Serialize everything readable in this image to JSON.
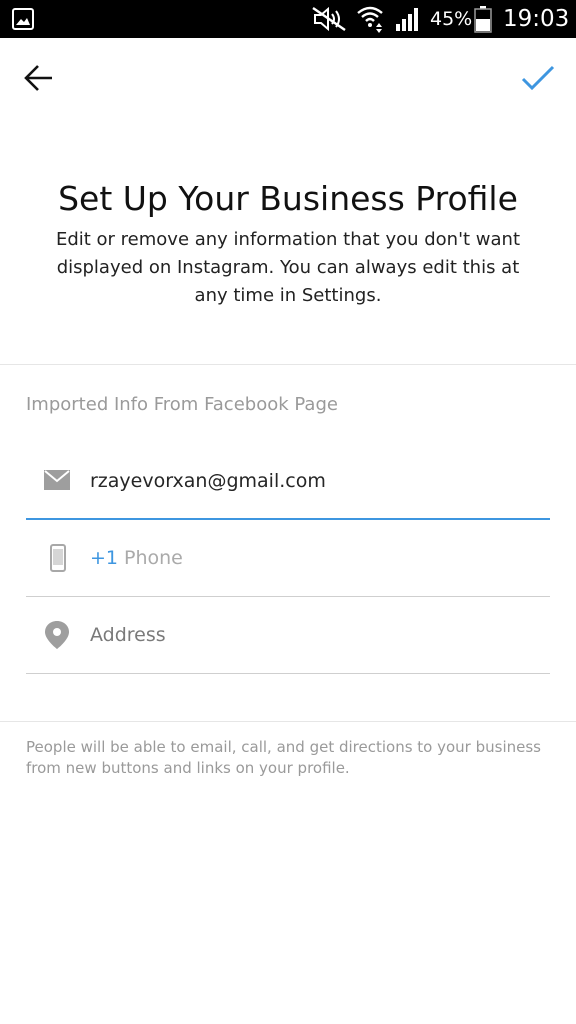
{
  "status_bar": {
    "battery_percent": "45%",
    "time": "19:03",
    "icons": [
      "gallery-icon",
      "mute-icon",
      "wifi-icon",
      "signal-icon",
      "battery-icon"
    ]
  },
  "header": {
    "back_icon": "back-arrow-icon",
    "done_icon": "checkmark-icon",
    "title": "Set Up Your Business Profile",
    "description": "Edit or remove any information that you don't want displayed on Instagram. You can always edit this at any time in Settings."
  },
  "form": {
    "section_label": "Imported Info From Facebook Page",
    "email": {
      "value": "rzayevorxan@gmail.com",
      "icon": "mail-icon"
    },
    "phone": {
      "country_code": "+1",
      "placeholder": "Phone",
      "icon": "phone-icon"
    },
    "address": {
      "placeholder": "Address",
      "icon": "location-pin-icon"
    }
  },
  "footer": {
    "note": "People will be able to email, call, and get directions to your business from new buttons and links on your profile."
  },
  "colors": {
    "accent": "#3e96e0",
    "status_bar_bg": "#000000"
  }
}
